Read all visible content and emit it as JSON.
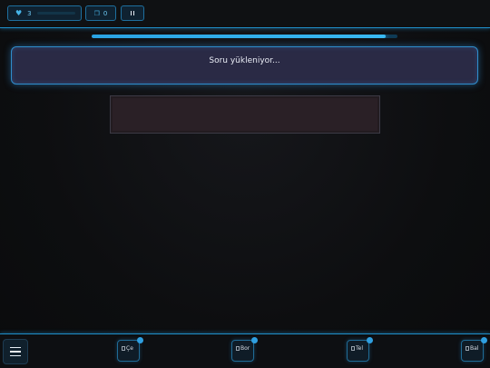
{
  "hud": {
    "lives_icon": "heart-icon",
    "lives": "3",
    "hints_icon": "cards-icon",
    "hints": "0",
    "pause_icon": "pause-icon"
  },
  "progress": {
    "fraction": 0.96
  },
  "question": {
    "text": "Soru yükleniyor..."
  },
  "bottom": {
    "menu_icon": "hamburger-menu-icon",
    "slots": [
      {
        "alt": "Çe",
        "badge": ""
      },
      {
        "alt": "Bor",
        "badge": ""
      },
      {
        "alt": "Tel",
        "badge": ""
      },
      {
        "alt": "Bal",
        "badge": ""
      }
    ]
  },
  "colors": {
    "accent": "#2f9fe0",
    "card_bg": "#2a2a45",
    "background": "#0c0d0f"
  }
}
